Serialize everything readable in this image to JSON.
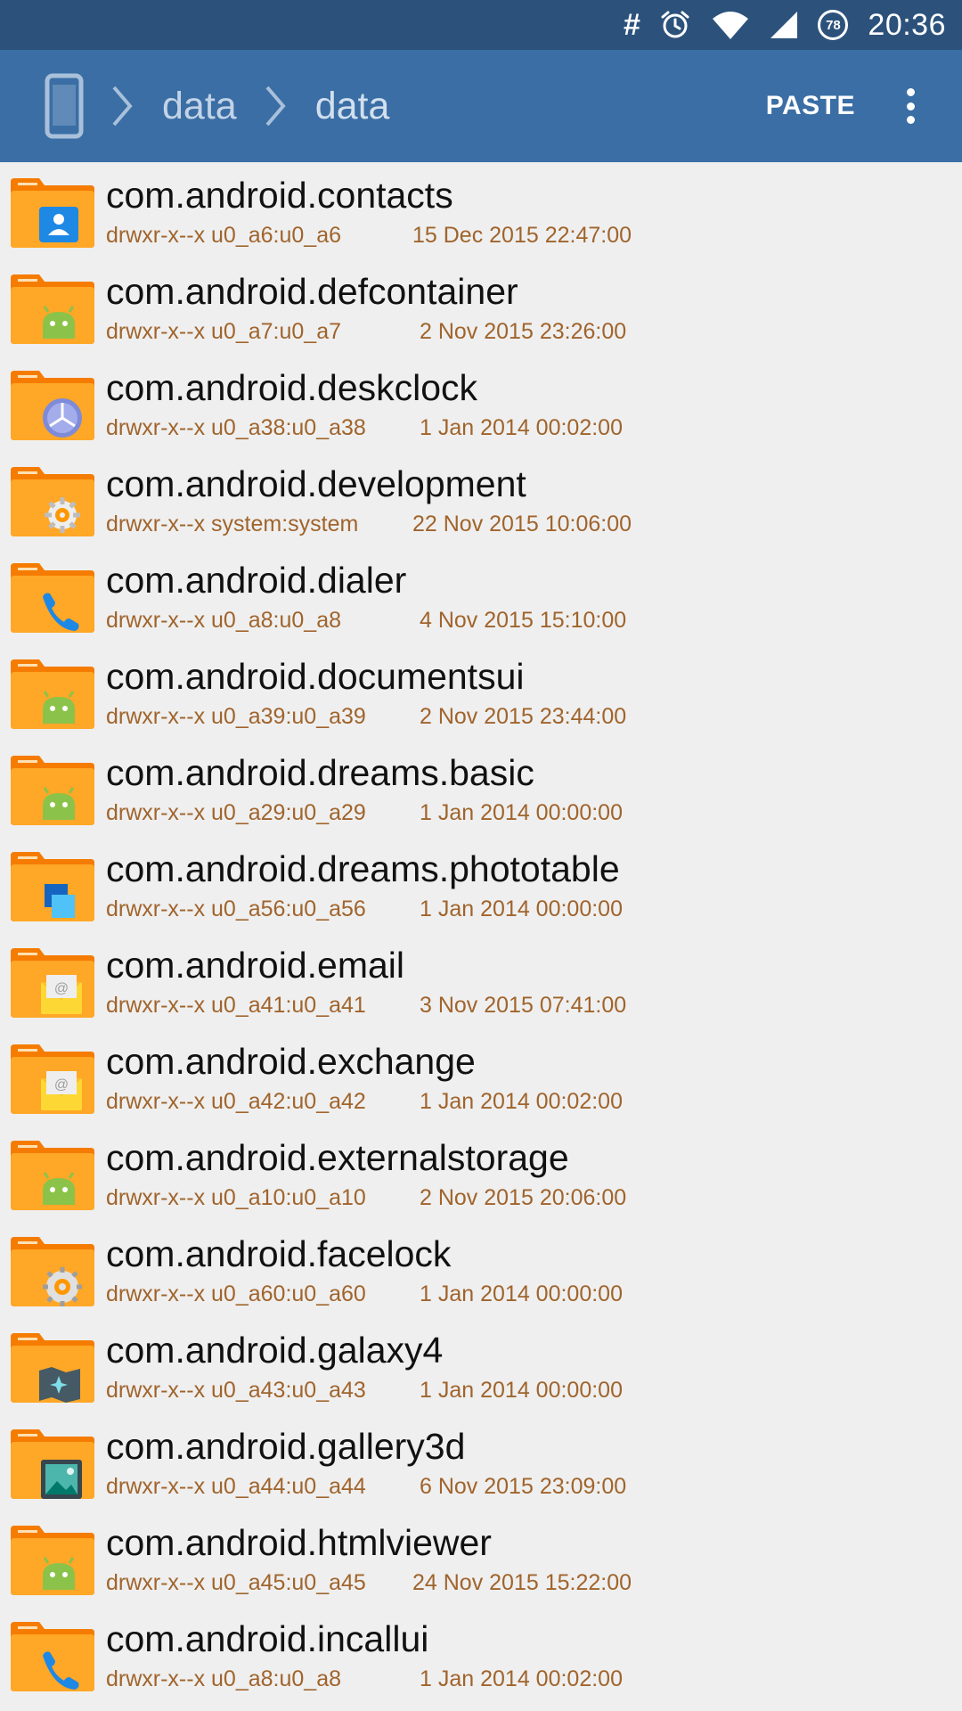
{
  "status_bar": {
    "time": "20:36",
    "battery_level": "78",
    "icons": [
      "hash-icon",
      "alarm-icon",
      "wifi-icon",
      "signal-icon",
      "battery-icon"
    ]
  },
  "toolbar": {
    "breadcrumbs": [
      "data",
      "data"
    ],
    "paste_label": "PASTE",
    "colors": {
      "status_bar": "#2c527c",
      "toolbar": "#3a6ea5",
      "folder": "#f5a623",
      "meta_text": "#a0642c"
    }
  },
  "files": [
    {
      "name": "com.android.contacts",
      "perm": "drwxr-x--x u0_a6:u0_a6",
      "date": "15 Dec 2015 22:47:00",
      "icon": "contacts-icon"
    },
    {
      "name": "com.android.defcontainer",
      "perm": "drwxr-x--x u0_a7:u0_a7",
      "date": "2 Nov 2015 23:26:00",
      "icon": "android-icon"
    },
    {
      "name": "com.android.deskclock",
      "perm": "drwxr-x--x u0_a38:u0_a38",
      "date": "1 Jan 2014 00:02:00",
      "icon": "clock-icon"
    },
    {
      "name": "com.android.development",
      "perm": "drwxr-x--x system:system",
      "date": "22 Nov 2015 10:06:00",
      "icon": "dev-settings-icon"
    },
    {
      "name": "com.android.dialer",
      "perm": "drwxr-x--x u0_a8:u0_a8",
      "date": "4 Nov 2015 15:10:00",
      "icon": "phone-icon"
    },
    {
      "name": "com.android.documentsui",
      "perm": "drwxr-x--x u0_a39:u0_a39",
      "date": "2 Nov 2015 23:44:00",
      "icon": "android-icon"
    },
    {
      "name": "com.android.dreams.basic",
      "perm": "drwxr-x--x u0_a29:u0_a29",
      "date": "1 Jan 2014 00:00:00",
      "icon": "android-icon"
    },
    {
      "name": "com.android.dreams.phototable",
      "perm": "drwxr-x--x u0_a56:u0_a56",
      "date": "1 Jan 2014 00:00:00",
      "icon": "phototable-icon"
    },
    {
      "name": "com.android.email",
      "perm": "drwxr-x--x u0_a41:u0_a41",
      "date": "3 Nov 2015 07:41:00",
      "icon": "email-icon"
    },
    {
      "name": "com.android.exchange",
      "perm": "drwxr-x--x u0_a42:u0_a42",
      "date": "1 Jan 2014 00:02:00",
      "icon": "email-icon"
    },
    {
      "name": "com.android.externalstorage",
      "perm": "drwxr-x--x u0_a10:u0_a10",
      "date": "2 Nov 2015 20:06:00",
      "icon": "android-icon"
    },
    {
      "name": "com.android.facelock",
      "perm": "drwxr-x--x u0_a60:u0_a60",
      "date": "1 Jan 2014 00:00:00",
      "icon": "gear-icon"
    },
    {
      "name": "com.android.galaxy4",
      "perm": "drwxr-x--x u0_a43:u0_a43",
      "date": "1 Jan 2014 00:00:00",
      "icon": "galaxy-map-icon"
    },
    {
      "name": "com.android.gallery3d",
      "perm": "drwxr-x--x u0_a44:u0_a44",
      "date": "6 Nov 2015 23:09:00",
      "icon": "gallery-icon"
    },
    {
      "name": "com.android.htmlviewer",
      "perm": "drwxr-x--x u0_a45:u0_a45",
      "date": "24 Nov 2015 15:22:00",
      "icon": "android-icon"
    },
    {
      "name": "com.android.incallui",
      "perm": "drwxr-x--x u0_a8:u0_a8",
      "date": "1 Jan 2014 00:02:00",
      "icon": "phone-icon"
    }
  ]
}
